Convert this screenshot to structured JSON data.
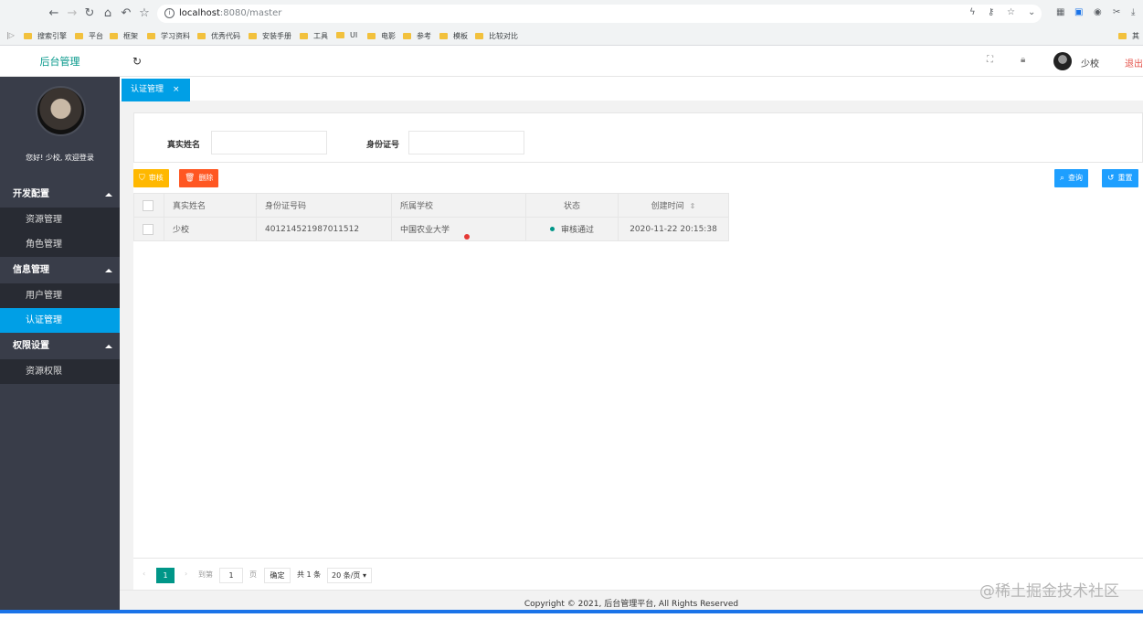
{
  "browser": {
    "url_host": "localhost",
    "url_path": ":8080/master",
    "bookmarks": [
      "搜索引擎",
      "平台",
      "框架",
      "学习资料",
      "优秀代码",
      "安装手册",
      "工具",
      "UI",
      "电影",
      "参考",
      "模板",
      "比较对比"
    ],
    "bookmark_right": "其"
  },
  "header": {
    "logo": "后台管理",
    "username": "少校",
    "logout": "退出"
  },
  "sidebar": {
    "welcome": "您好! 少校, 欢迎登录",
    "groups": [
      {
        "label": "开发配置",
        "items": [
          "资源管理",
          "角色管理"
        ]
      },
      {
        "label": "信息管理",
        "items": [
          "用户管理",
          "认证管理"
        ]
      },
      {
        "label": "权限设置",
        "items": [
          "资源权限"
        ]
      }
    ],
    "active_item": "认证管理"
  },
  "tabs": {
    "active": "认证管理",
    "close": "×"
  },
  "search": {
    "name_label": "真实姓名",
    "id_label": "身份证号",
    "query_button": "查询",
    "reset_button": "重置"
  },
  "toolbar": {
    "approve_button": "审核",
    "delete_button": "删除"
  },
  "table": {
    "columns": [
      "真实姓名",
      "身份证号码",
      "所属学校",
      "状态",
      "创建时间"
    ],
    "rows": [
      {
        "name": "少校",
        "id_no": "401214521987011512",
        "school": "中国农业大学",
        "status": "审核通过",
        "created": "2020-11-22 20:15:38"
      }
    ]
  },
  "pager": {
    "prev": "‹",
    "current": "1",
    "next": "›",
    "goto_label": "到第",
    "goto_value": "1",
    "page_unit": "页",
    "confirm": "确定",
    "total": "共 1 条",
    "page_size": "20 条/页"
  },
  "footer": {
    "text": "Copyright © 2021, 后台管理平台, All Rights Reserved"
  },
  "watermark": "@稀土掘金技术社区",
  "colors": {
    "accent": "#009fe6",
    "primary": "#009688",
    "warn": "#ffb800",
    "danger": "#ff5722",
    "sidebar": "#393d49"
  }
}
